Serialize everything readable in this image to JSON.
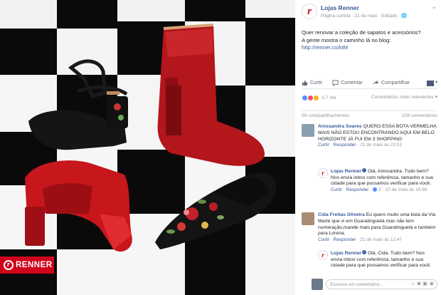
{
  "photo": {
    "brand_logo_text": "RENNER",
    "brand_mark": "r"
  },
  "post": {
    "avatar_letter": "r",
    "page_name": "Lojas Renner",
    "meta": "Página curtida · 21 de maio · Editado · 🌐",
    "menu_icon": "chevron-down-icon",
    "text_line1": "Quer renovar a coleção de sapatos e acessórios?",
    "text_line2": "A gente mostra o caminho lá no blog: ",
    "link": "http://renner.co/ktM"
  },
  "actions": {
    "like": "Curtir",
    "comment": "Comentar",
    "share": "Compartilhar"
  },
  "reactions": {
    "count": "3,7 mil",
    "sort": "Comentários mais relevantes ▾",
    "colors": {
      "like": "#5890ff",
      "love": "#f25268",
      "wow": "#f7b125"
    }
  },
  "counts": {
    "shares": "59 compartilhamentos",
    "comments": "108 comentários"
  },
  "comments": [
    {
      "name": "Anissandra Soares",
      "text": " QUERO ESSA BOTA VERMELHA MAIS NÃO ESTOU ENCONTRANDO AQUI EM BELO HORIZONTE JÁ FUI EM 3 SHOPPING",
      "like": "Curtir",
      "reply": "Responder",
      "time": "21 de maio às 23:51",
      "reply_item": {
        "name": "Lojas Renner",
        "text": " Olá, Anissandra. Tudo bem? Nos envia inbox com referência, tamanho e sua cidade para que possamos verificar para você.",
        "like": "Curtir",
        "reply": "Responder",
        "replies": "2",
        "time": "22 de maio às 10:56"
      }
    },
    {
      "name": "Cida Freitas Oliveira",
      "text": " Eu quero muito uma bota da Via Marte que vi em Guaratinguetá mas não tem numeração,mande mais para Guaratinguetá e também para Lorena.",
      "like": "Curtir",
      "reply": "Responder",
      "time": "21 de maio às 12:47",
      "reply_item": {
        "name": "Lojas Renner",
        "text": " Olá, Cida. Tudo bem? Nos envia inbox com referência, tamanho e sua cidade para que possamos verificar para você."
      }
    }
  ],
  "composer": {
    "placeholder": "Escreva um comentário..."
  }
}
